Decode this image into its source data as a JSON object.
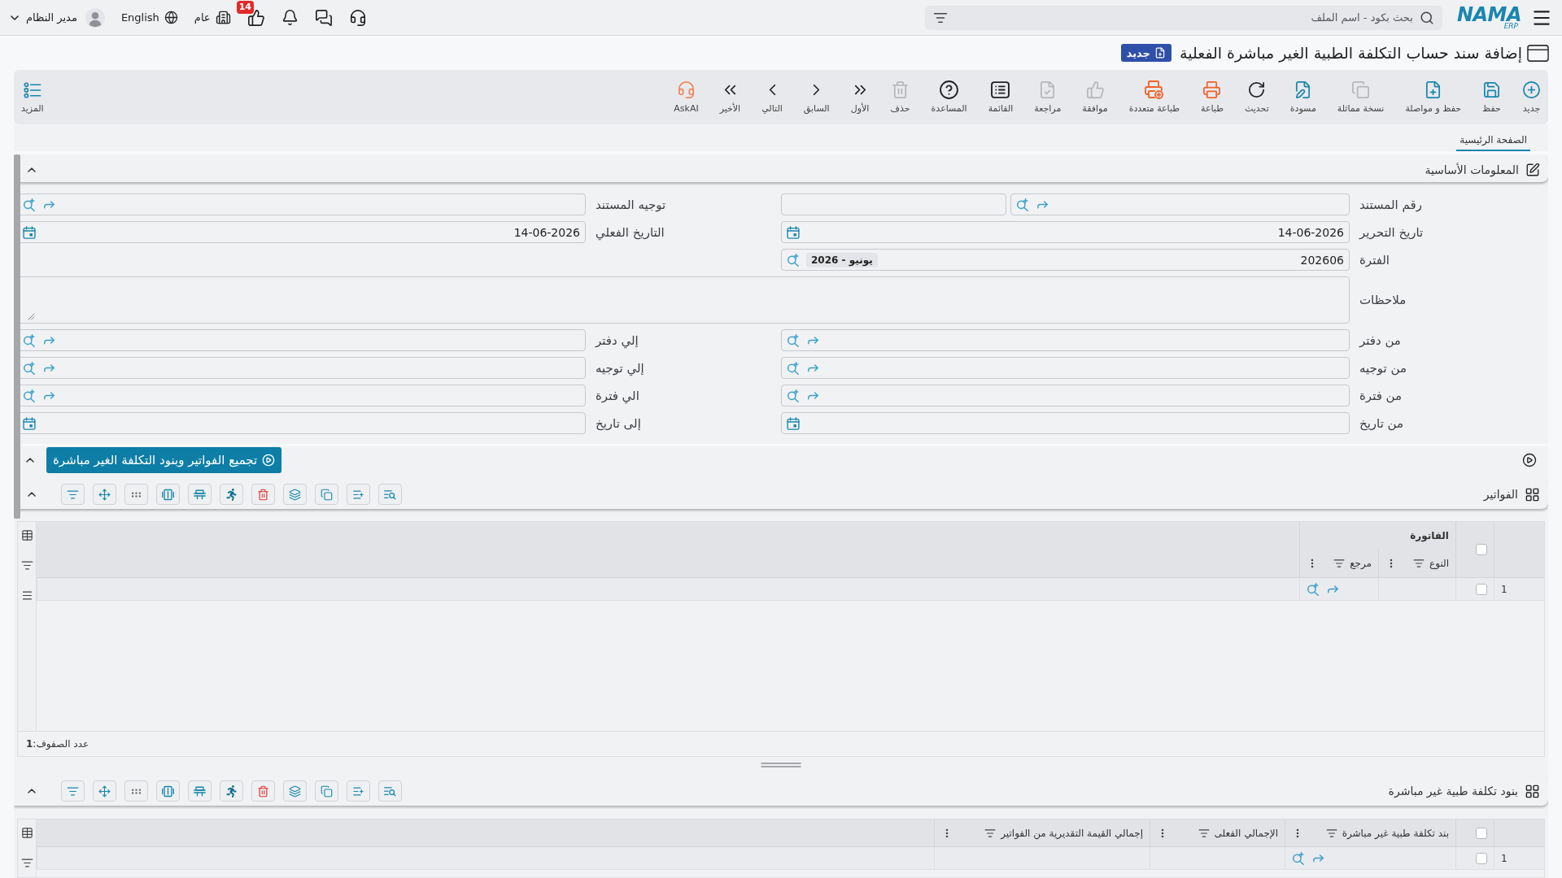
{
  "top_bar": {
    "logo": {
      "wordmark": "NAMA",
      "subtitle": "ERP"
    },
    "search": {
      "placeholder": "بحث بكود - اسم الملف"
    },
    "notification_count": "14",
    "company": "عام",
    "language": "English",
    "user": "مدير النظام"
  },
  "page_header": {
    "title": "إضافة سند حساب التكلفة الطبية الغير مباشرة الفعلية",
    "status": "جديد"
  },
  "toolbar": [
    {
      "label": "جديد",
      "disabled": false
    },
    {
      "label": "حفظ",
      "disabled": false
    },
    {
      "label": "حفظ و مواصلة",
      "disabled": false
    },
    {
      "label": "نسخة مماثلة",
      "disabled": true
    },
    {
      "label": "مسودة",
      "disabled": false
    },
    {
      "label": "تحديث",
      "disabled": false
    },
    {
      "label": "طباعة",
      "disabled": false
    },
    {
      "label": "طباعة متعددة",
      "disabled": false
    },
    {
      "label": "موافقة",
      "disabled": true
    },
    {
      "label": "مراجعة",
      "disabled": true
    },
    {
      "label": "القائمة",
      "disabled": false
    },
    {
      "label": "المساعدة",
      "disabled": false
    },
    {
      "label": "حذف",
      "disabled": true
    },
    {
      "label": "الأول",
      "disabled": false
    },
    {
      "label": "السابق",
      "disabled": false
    },
    {
      "label": "التالي",
      "disabled": false
    },
    {
      "label": "الأخير",
      "disabled": false
    },
    {
      "label": "AskAI",
      "disabled": false
    }
  ],
  "toolbar_more": {
    "label": "المزيد"
  },
  "tabs": [
    {
      "label": "الصفحة الرئيسية",
      "selected": true
    }
  ],
  "basic_info": {
    "title": "المعلومات الأساسية",
    "expanded": true,
    "rows": [
      {
        "fields": [
          {
            "label": "رقم المستند",
            "kind": "lookup_split"
          },
          {
            "label": "توجيه المستند",
            "kind": "lookup"
          }
        ]
      },
      {
        "fields": [
          {
            "label": "تاريخ التحرير",
            "kind": "date",
            "value": "14-06-2026"
          },
          {
            "label": "التاريخ الفعلي",
            "kind": "date",
            "value": "14-06-2026"
          }
        ]
      },
      {
        "fields": [
          {
            "label": "الفترة",
            "kind": "period",
            "value": "202606",
            "tag": "يونيو - 2026"
          }
        ]
      },
      {
        "fields": [
          {
            "label": "ملاحظات",
            "kind": "textarea"
          }
        ]
      },
      {
        "fields": [
          {
            "label": "من دفتر",
            "kind": "lookup"
          },
          {
            "label": "إلي دفتر",
            "kind": "lookup"
          }
        ]
      },
      {
        "fields": [
          {
            "label": "من توجيه",
            "kind": "lookup"
          },
          {
            "label": "إلي توجيه",
            "kind": "lookup"
          }
        ]
      },
      {
        "fields": [
          {
            "label": "من فترة",
            "kind": "lookup"
          },
          {
            "label": "الي فترة",
            "kind": "lookup"
          }
        ]
      },
      {
        "fields": [
          {
            "label": "من تاريخ",
            "kind": "date"
          },
          {
            "label": "إلى تاريخ",
            "kind": "date"
          }
        ]
      }
    ]
  },
  "collect": {
    "button": "تجميع الفواتير وبنود التكلفة الغير مباشرة",
    "expanded": true
  },
  "invoices": {
    "title": "الفواتير",
    "expanded": true,
    "all_checked": false,
    "group_header": "الفاتورة",
    "columns": [
      {
        "label": "النوع"
      },
      {
        "label": "مرجع"
      }
    ],
    "rows": [
      {
        "number": "1",
        "checked": false,
        "cells": [
          {
            "kind": "blank"
          },
          {
            "kind": "lookup"
          }
        ]
      }
    ],
    "row_count": "عدد الصفوف:**1**"
  },
  "cost_items": {
    "title": "بنود تكلفة طبية غير مباشرة",
    "expanded": true,
    "all_checked": false,
    "columns": [
      {
        "label": "بند تكلفة طبية غير مباشرة"
      },
      {
        "label": "الإجمالي الفعلى"
      },
      {
        "label": "إجمالي القيمة التقديرية من الفواتير"
      }
    ],
    "rows": [
      {
        "number": "1",
        "checked": false,
        "cells": [
          {
            "kind": "lookup"
          },
          {
            "kind": "blank"
          },
          {
            "kind": "blank"
          }
        ]
      }
    ]
  }
}
